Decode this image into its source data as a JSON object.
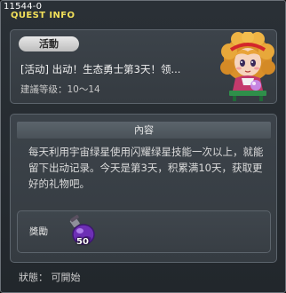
{
  "header": {
    "id": "11544-0",
    "title": "QUEST INFO"
  },
  "quest": {
    "category_badge": "活動",
    "name": "[活动] 出动！生态勇士第3天！领...",
    "level": "建議等级：10～14"
  },
  "content": {
    "section_title": "內容",
    "description": "每天利用宇宙绿星使用闪耀绿星技能一次以上，就能留下出动记录。今天是第3天，积累满10天，获取更好的礼物吧。"
  },
  "reward": {
    "label": "獎勵",
    "quantity": "50",
    "item_icon": "purple-potion-icon"
  },
  "status": {
    "text": "狀態： 可開始"
  },
  "colors": {
    "title_yellow": "#f2e05a",
    "panel": "#3a4046",
    "window_bg": "#2a3036"
  }
}
